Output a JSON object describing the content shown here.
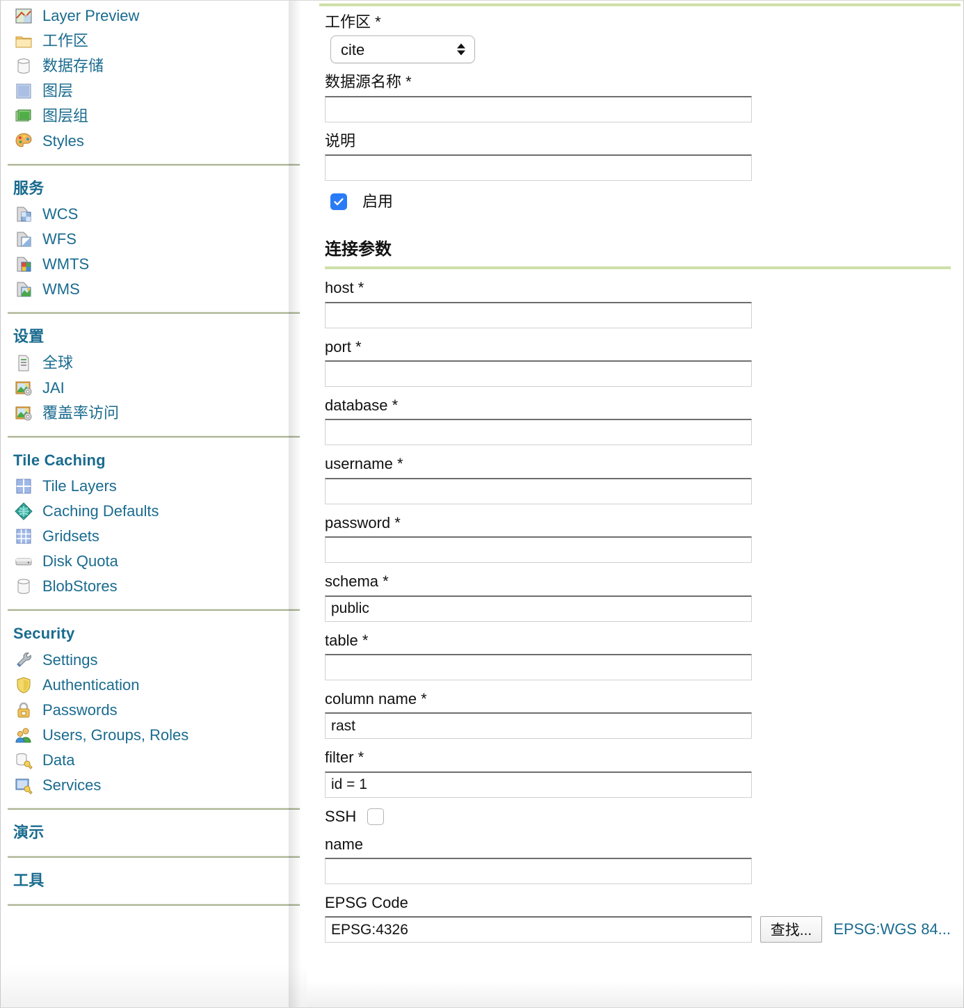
{
  "sidebar": {
    "groups": [
      {
        "heading": null,
        "items": [
          {
            "label": "Layer Preview",
            "icon": "layer-preview-icon"
          },
          {
            "label": "工作区",
            "icon": "folder-icon"
          },
          {
            "label": "数据存储",
            "icon": "database-icon"
          },
          {
            "label": "图层",
            "icon": "layer-icon"
          },
          {
            "label": "图层组",
            "icon": "layergroup-icon"
          },
          {
            "label": "Styles",
            "icon": "palette-icon"
          }
        ]
      },
      {
        "heading": "服务",
        "items": [
          {
            "label": "WCS",
            "icon": "wcs-icon"
          },
          {
            "label": "WFS",
            "icon": "wfs-icon"
          },
          {
            "label": "WMTS",
            "icon": "wmts-icon"
          },
          {
            "label": "WMS",
            "icon": "wms-icon"
          }
        ]
      },
      {
        "heading": "设置",
        "items": [
          {
            "label": "全球",
            "icon": "server-icon"
          },
          {
            "label": "JAI",
            "icon": "image-settings-icon"
          },
          {
            "label": "覆盖率访问",
            "icon": "coverage-access-icon"
          }
        ]
      },
      {
        "heading": "Tile Caching",
        "items": [
          {
            "label": "Tile Layers",
            "icon": "tile-layers-icon"
          },
          {
            "label": "Caching Defaults",
            "icon": "globe-icon"
          },
          {
            "label": "Gridsets",
            "icon": "gridsets-icon"
          },
          {
            "label": "Disk Quota",
            "icon": "disk-quota-icon"
          },
          {
            "label": "BlobStores",
            "icon": "blobstores-icon"
          }
        ]
      },
      {
        "heading": "Security",
        "items": [
          {
            "label": "Settings",
            "icon": "wrench-icon"
          },
          {
            "label": "Authentication",
            "icon": "shield-icon"
          },
          {
            "label": "Passwords",
            "icon": "lock-icon"
          },
          {
            "label": "Users, Groups, Roles",
            "icon": "users-icon"
          },
          {
            "label": "Data",
            "icon": "data-key-icon"
          },
          {
            "label": "Services",
            "icon": "services-key-icon"
          }
        ]
      },
      {
        "heading": "演示",
        "items": []
      },
      {
        "heading": "工具",
        "items": []
      }
    ]
  },
  "main": {
    "workspace": {
      "label": "工作区 *",
      "value": "cite",
      "options": [
        "cite"
      ]
    },
    "datasource_name": {
      "label": "数据源名称 *",
      "value": "",
      "placeholder": ""
    },
    "description": {
      "label": "说明",
      "value": "",
      "placeholder": ""
    },
    "enabled": {
      "label": "启用",
      "checked": true
    },
    "connection_params": {
      "title": "连接参数",
      "fields": [
        {
          "label": "host *",
          "value": "",
          "name": "host"
        },
        {
          "label": "port *",
          "value": "",
          "name": "port"
        },
        {
          "label": "database *",
          "value": "",
          "name": "database"
        },
        {
          "label": "username *",
          "value": "",
          "name": "username"
        },
        {
          "label": "password *",
          "value": "",
          "name": "password"
        },
        {
          "label": "schema *",
          "value": "public",
          "name": "schema"
        },
        {
          "label": "table *",
          "value": "",
          "name": "table"
        },
        {
          "label": "column name *",
          "value": "rast",
          "name": "column-name"
        },
        {
          "label": "filter *",
          "value": "id = 1",
          "name": "filter"
        }
      ],
      "ssh": {
        "label": "SSH",
        "checked": false
      },
      "name_field": {
        "label": "name",
        "value": ""
      },
      "epsg": {
        "label": "EPSG Code",
        "value": "EPSG:4326",
        "find_button": "查找...",
        "link": "EPSG:WGS 84..."
      }
    }
  },
  "colors": {
    "link": "#1a6b8f",
    "rule_green": "#cfe0a8",
    "sidebar_divider": "#a9b394",
    "checkbox_blue": "#2a7bf6"
  }
}
